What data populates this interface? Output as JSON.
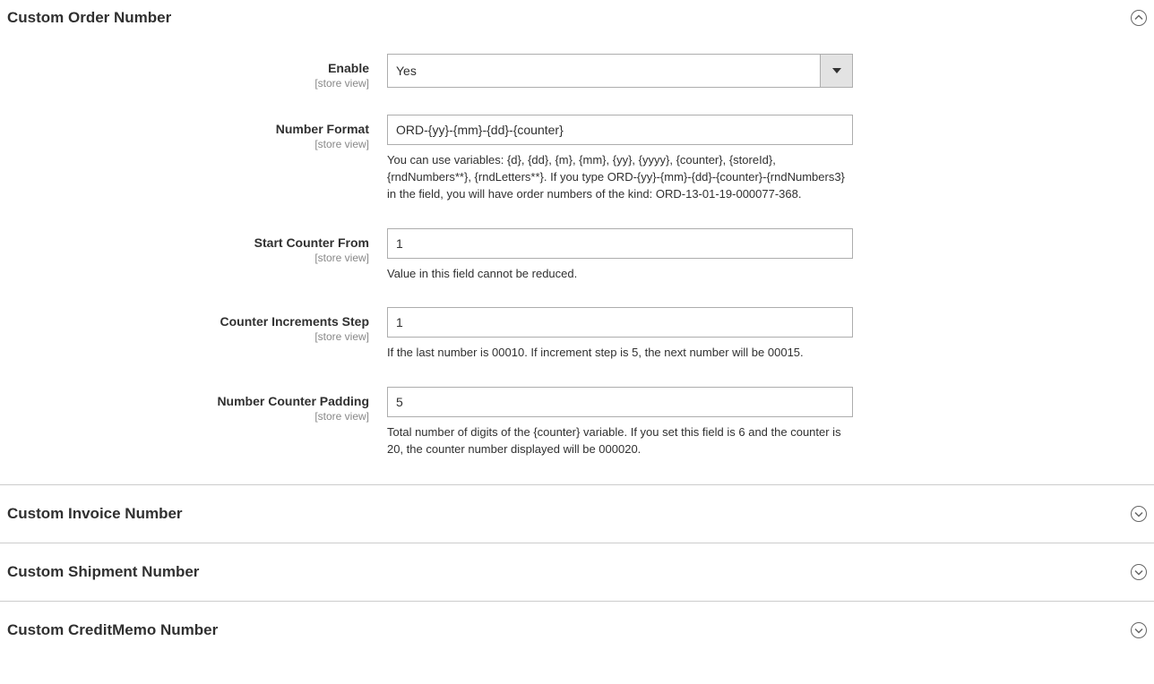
{
  "sections": {
    "order": {
      "title": "Custom Order Number",
      "expanded": true
    },
    "invoice": {
      "title": "Custom Invoice Number",
      "expanded": false
    },
    "shipment": {
      "title": "Custom Shipment Number",
      "expanded": false
    },
    "creditmemo": {
      "title": "Custom CreditMemo Number",
      "expanded": false
    }
  },
  "scopeLabel": "[store view]",
  "fields": {
    "enable": {
      "label": "Enable",
      "value": "Yes"
    },
    "numberFormat": {
      "label": "Number Format",
      "value": "ORD-{yy}-{mm}-{dd}-{counter}",
      "help": "You can use variables: {d}, {dd}, {m}, {mm}, {yy}, {yyyy}, {counter}, {storeId}, {rndNumbers**}, {rndLetters**}. If you type ORD-{yy}-{mm}-{dd}-{counter}-{rndNumbers3} in the field, you will have order numbers of the kind: ORD-13-01-19-000077-368."
    },
    "startCounter": {
      "label": "Start Counter From",
      "value": "1",
      "help": "Value in this field cannot be reduced."
    },
    "incrementStep": {
      "label": "Counter Increments Step",
      "value": "1",
      "help": "If the last number is 00010. If increment step is 5, the next number will be 00015."
    },
    "counterPadding": {
      "label": "Number Counter Padding",
      "value": "5",
      "help": "Total number of digits of the {counter} variable. If you set this field is 6 and the counter is 20, the counter number displayed will be 000020."
    }
  }
}
